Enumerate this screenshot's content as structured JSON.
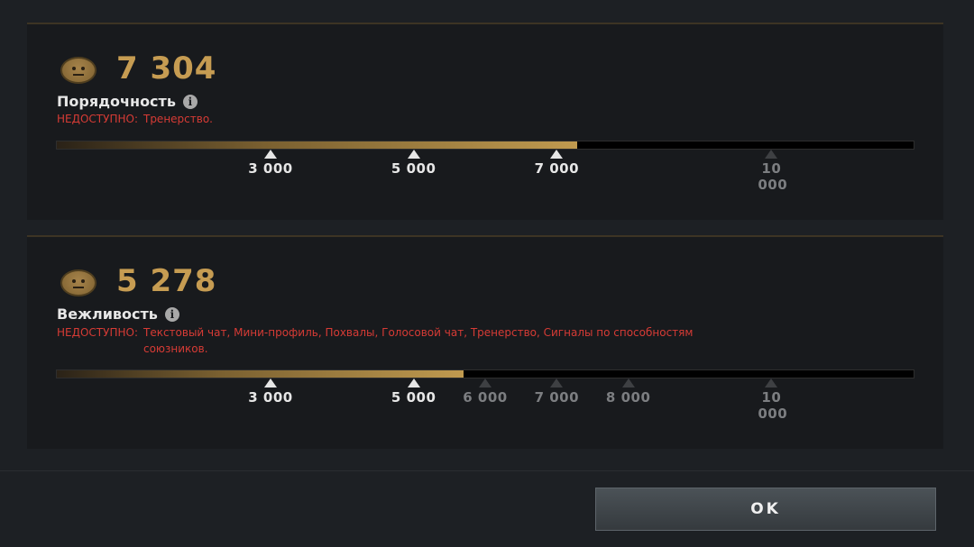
{
  "conduct": {
    "score": "7 304",
    "value": 7304,
    "title": "Порядочность",
    "info_icon": "i",
    "unavailable_label": "НЕДОСТУПНО:",
    "unavailable_items": "Тренерство.",
    "fill_percent": 60.7,
    "ticks": [
      {
        "label": "3 000",
        "value": 3000,
        "locked": false
      },
      {
        "label": "5 000",
        "value": 5000,
        "locked": false
      },
      {
        "label": "7 000",
        "value": 7000,
        "locked": false
      },
      {
        "label": "10 000",
        "value": 10000,
        "locked": true
      }
    ]
  },
  "behavior": {
    "score": "5 278",
    "value": 5278,
    "title": "Вежливость",
    "info_icon": "i",
    "unavailable_label": "НЕДОСТУПНО:",
    "unavailable_items_line1": "Текстовый чат, Мини-профиль, Похвалы, Голосовой чат, Тренерство, Сигналы по способностям",
    "unavailable_items_line2": "союзников.",
    "fill_percent": 47.5,
    "ticks": [
      {
        "label": "3 000",
        "value": 3000,
        "locked": false
      },
      {
        "label": "5 000",
        "value": 5000,
        "locked": false
      },
      {
        "label": "6 000",
        "value": 6000,
        "locked": true
      },
      {
        "label": "7 000",
        "value": 7000,
        "locked": true
      },
      {
        "label": "8 000",
        "value": 8000,
        "locked": true
      },
      {
        "label": "10 000",
        "value": 10000,
        "locked": true
      }
    ]
  },
  "ok_button": "OK",
  "colors": {
    "accent_gold": "#c69c52",
    "unavailable_red": "#d63b35",
    "locked_gray": "#7c7e81"
  }
}
